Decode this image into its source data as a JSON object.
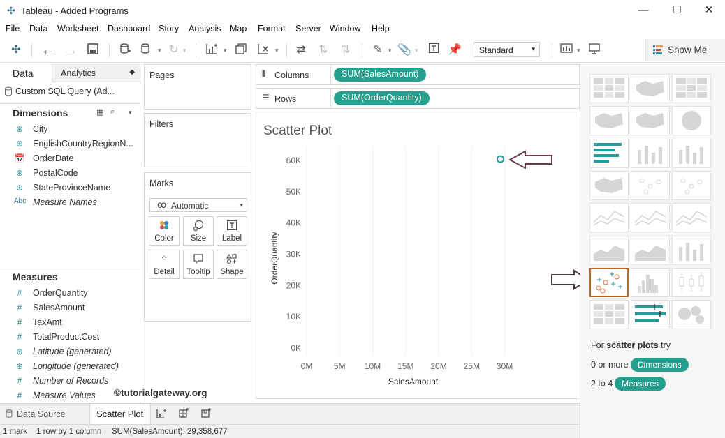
{
  "window": {
    "title": "Tableau - Added Programs",
    "controls": [
      "—",
      "☐",
      "✕"
    ]
  },
  "menu": [
    "File",
    "Data",
    "Worksheet",
    "Dashboard",
    "Story",
    "Analysis",
    "Map",
    "Format",
    "Server",
    "Window",
    "Help"
  ],
  "toolbar": {
    "fit_select": "Standard",
    "show_me_label": "Show Me"
  },
  "data_pane": {
    "tabs": {
      "data": "Data",
      "analytics": "Analytics"
    },
    "datasource": "Custom SQL Query (Ad...",
    "dimensions_title": "Dimensions",
    "dimensions": [
      {
        "name": "City",
        "icon": "globe-icon"
      },
      {
        "name": "EnglishCountryRegionN...",
        "icon": "globe-icon"
      },
      {
        "name": "OrderDate",
        "icon": "calendar-icon"
      },
      {
        "name": "PostalCode",
        "icon": "globe-icon"
      },
      {
        "name": "StateProvinceName",
        "icon": "globe-icon"
      },
      {
        "name": "Measure Names",
        "icon": "abc-icon",
        "abc": "Abc"
      }
    ],
    "measures_title": "Measures",
    "measures": [
      {
        "name": "OrderQuantity",
        "icon": "number-icon"
      },
      {
        "name": "SalesAmount",
        "icon": "number-icon"
      },
      {
        "name": "TaxAmt",
        "icon": "number-icon"
      },
      {
        "name": "TotalProductCost",
        "icon": "number-icon"
      },
      {
        "name": "Latitude (generated)",
        "icon": "globe-icon"
      },
      {
        "name": "Longitude (generated)",
        "icon": "globe-icon"
      },
      {
        "name": "Number of Records",
        "icon": "number-icon"
      },
      {
        "name": "Measure Values",
        "icon": "number-icon"
      }
    ]
  },
  "cards": {
    "pages": "Pages",
    "filters": "Filters",
    "marks": "Marks",
    "mark_type": "Automatic",
    "mark_buttons": [
      "Color",
      "Size",
      "Label",
      "Detail",
      "Tooltip",
      "Shape"
    ]
  },
  "shelves": {
    "columns_label": "Columns",
    "columns_pill": "SUM(SalesAmount)",
    "rows_label": "Rows",
    "rows_pill": "SUM(OrderQuantity)"
  },
  "sheet": {
    "title": "Scatter Plot"
  },
  "chart_data": {
    "type": "scatter",
    "title": "Scatter Plot",
    "xlabel": "SalesAmount",
    "ylabel": "OrderQuantity",
    "xlim": [
      0,
      31000000
    ],
    "ylim": [
      0,
      62000
    ],
    "x_ticks": [
      0,
      5000000,
      10000000,
      15000000,
      20000000,
      25000000,
      30000000
    ],
    "x_tick_labels": [
      "0M",
      "5M",
      "10M",
      "15M",
      "20M",
      "25M",
      "30M"
    ],
    "y_ticks": [
      0,
      10000,
      20000,
      30000,
      40000,
      50000,
      60000
    ],
    "y_tick_labels": [
      "0K",
      "10K",
      "20K",
      "30K",
      "40K",
      "50K",
      "60K"
    ],
    "points": [
      {
        "x": 29358677,
        "y": 60398
      }
    ],
    "marker": "open-circle",
    "color": "#2a9a9a",
    "grid": "vertical",
    "legend": "none"
  },
  "show_me": {
    "hint_prefix": "For",
    "hint_bold": "scatter plots",
    "hint_suffix": "try",
    "row1_prefix": "0 or more",
    "row1_pill": "Dimensions",
    "row2_prefix": "2 to 4",
    "row2_pill": "Measures"
  },
  "bottom": {
    "datasource_tab": "Data Source",
    "sheet_tab": "Scatter Plot"
  },
  "status": {
    "marks": "1 mark",
    "dims": "1 row by 1 column",
    "sum": "SUM(SalesAmount): 29,358,677"
  },
  "watermark": "©tutorialgateway.org",
  "colors": {
    "pill": "#26a08e",
    "highlight": "#b26a2e",
    "mark": "#2a9a9a"
  }
}
